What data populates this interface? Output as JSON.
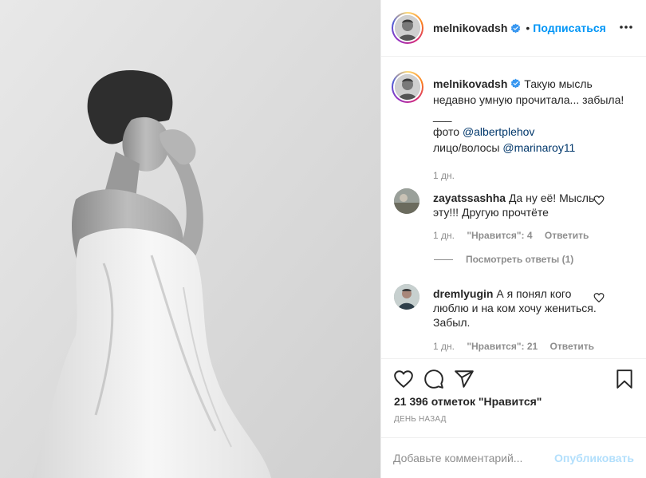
{
  "header": {
    "username": "melnikovadsh",
    "separator": "•",
    "follow_label": "Подписаться"
  },
  "caption": {
    "username": "melnikovadsh",
    "text": "Такую мысль недавно умную прочитала... забыла!",
    "divider": "___",
    "photo_prefix": "фото",
    "photo_mention": "@albertplehov",
    "hair_prefix": "лицо/волосы",
    "hair_mention": "@marinaroy11",
    "time": "1 дн."
  },
  "comments": [
    {
      "username": "zayatssashha",
      "text": "Да ну её! Мысль эту!!! Другую прочтёте",
      "time": "1 дн.",
      "likes": "\"Нравится\": 4",
      "reply": "Ответить"
    },
    {
      "username": "dremlyugin",
      "text": "А я понял кого люблю и на ком хочу жениться. Забыл.",
      "time": "1 дн.",
      "likes": "\"Нравится\": 21",
      "reply": "Ответить"
    }
  ],
  "view_replies": "Посмотреть ответы (1)",
  "likes_text": "21 396 отметок \"Нравится\"",
  "posted_ago": "ДЕНЬ НАЗАД",
  "add_comment": {
    "placeholder": "Добавьте комментарий...",
    "publish_label": "Опубликовать"
  },
  "colors": {
    "accent": "#0095f6",
    "publish_disabled": "#b2dffc",
    "muted": "#8e8e8e",
    "text": "#262626",
    "mention": "#00376b"
  },
  "icons": [
    "heart-icon",
    "comment-icon",
    "share-icon",
    "bookmark-icon",
    "more-icon",
    "verified-icon",
    "small-heart-icon"
  ]
}
